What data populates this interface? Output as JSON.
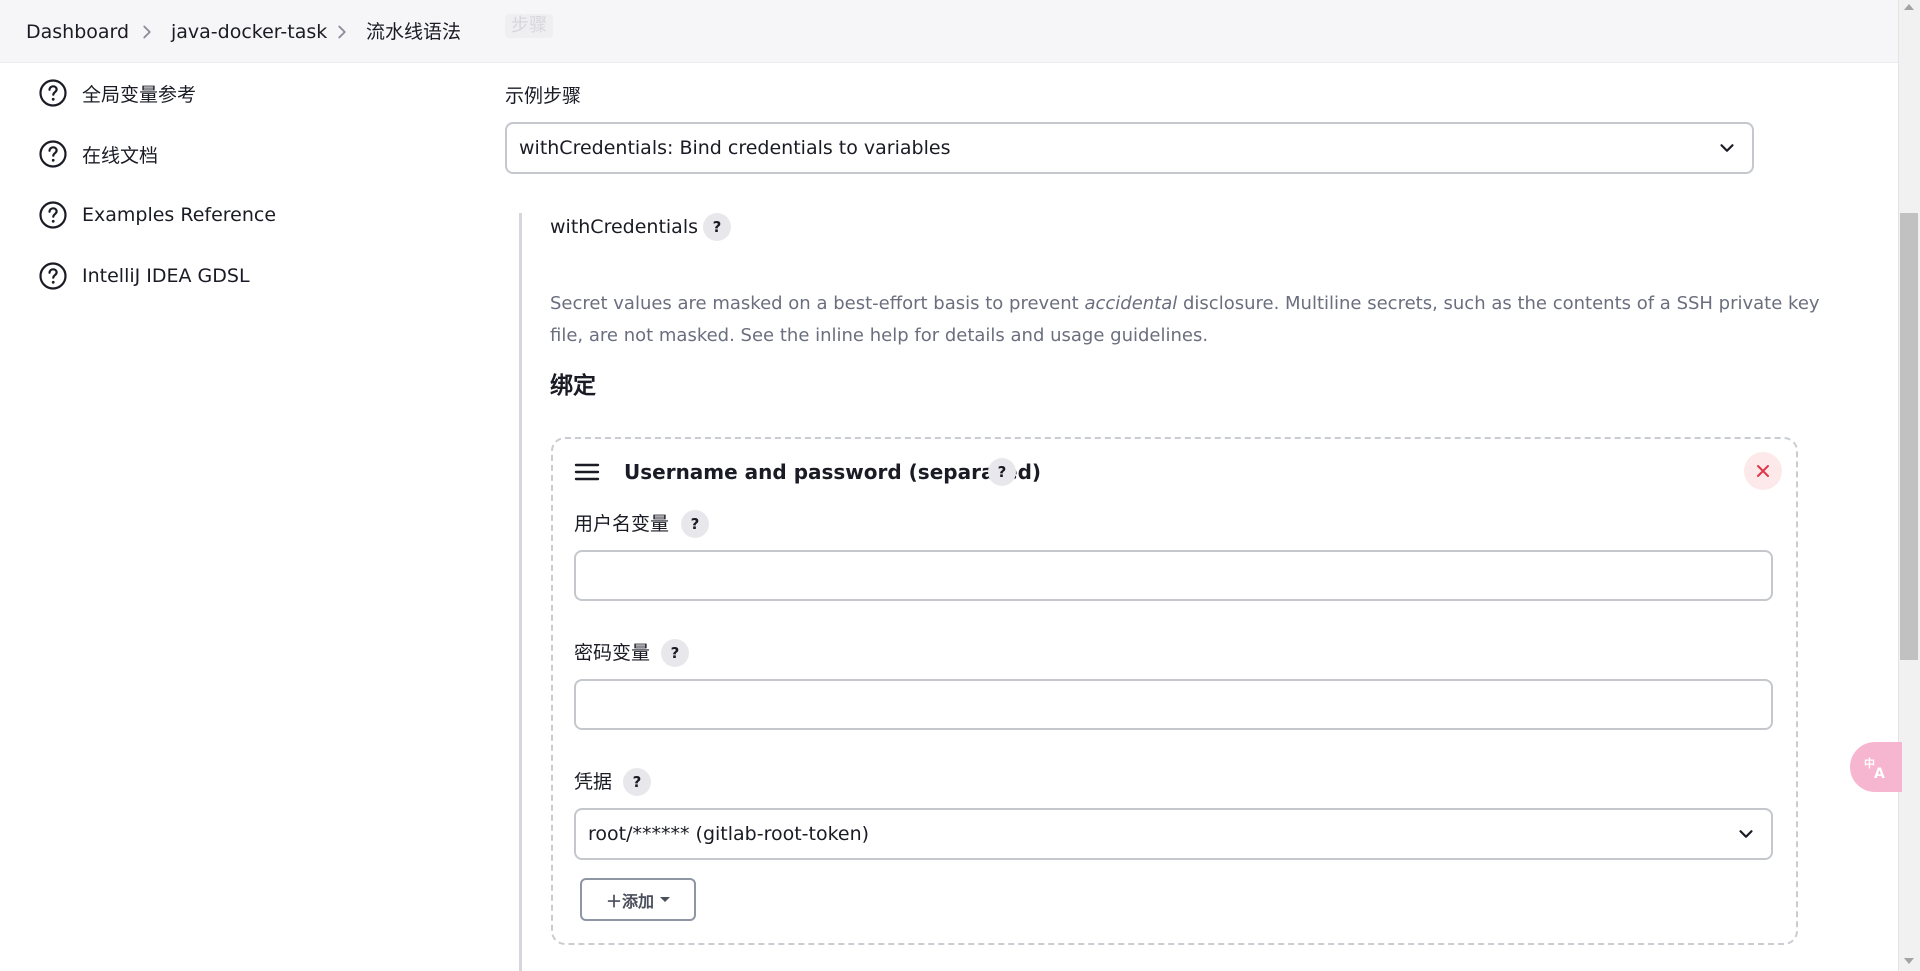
{
  "breadcrumb": {
    "items": [
      "Dashboard",
      "java-docker-task",
      "流水线语法"
    ],
    "ghost_label": "步骤"
  },
  "sidebar": {
    "items": [
      {
        "label": "全局变量参考",
        "icon": "help-circle-icon"
      },
      {
        "label": "在线文档",
        "icon": "help-circle-icon"
      },
      {
        "label": "Examples Reference",
        "icon": "help-circle-icon"
      },
      {
        "label": "IntelliJ IDEA GDSL",
        "icon": "help-circle-icon"
      }
    ]
  },
  "main": {
    "sample_step_label": "示例步骤",
    "sample_step_value": "withCredentials: Bind credentials to variables",
    "step_name": "withCredentials",
    "help_glyph": "?",
    "description_before": "Secret values are masked on a best-effort basis to prevent ",
    "description_emphasis": "accidental",
    "description_after": " disclosure. Multiline secrets, such as the contents of a SSH private key file, are not masked. See the inline help for details and usage guidelines.",
    "bindings_title": "绑定",
    "binding": {
      "title": "Username and password (separated)",
      "username_var_label": "用户名变量",
      "username_var_value": "",
      "password_var_label": "密码变量",
      "password_var_value": "",
      "credentials_label": "凭据",
      "credentials_value": "root/****** (gitlab-root-token)",
      "add_button_label": "＋添加"
    }
  },
  "colors": {
    "topbar_bg": "#f6f6f8",
    "text": "#1a1b24",
    "muted_text": "#6b6e7e",
    "close_bg": "#fde8ea",
    "close_icon": "#e0374b",
    "translate_widget": "#f7b6cf"
  }
}
